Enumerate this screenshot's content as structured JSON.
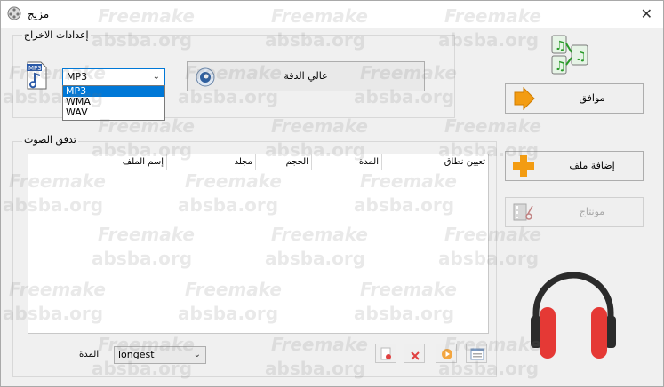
{
  "window": {
    "title": "مزيج",
    "close_glyph": "✕"
  },
  "output_settings": {
    "label": "إعدادات الاخراج",
    "format_select": {
      "value": "MP3",
      "options": [
        "MP3",
        "WMA",
        "WAV"
      ],
      "selected_index": 0
    },
    "quality_button_label": "عالي الدقة",
    "file_icon_text": "MP3"
  },
  "audio_stream": {
    "label": "تدفق الصوت",
    "columns": [
      "إسم الملف",
      "مجلد",
      "الحجم",
      "المدة",
      "تعيين نطاق"
    ]
  },
  "duration": {
    "label": "المدة",
    "value": "longest"
  },
  "actions": {
    "ok_label": "موافق",
    "add_file_label": "إضافة ملف",
    "montage_label": "مونتاج"
  },
  "watermark": {
    "line1": "Freemake",
    "line2": "absba.org"
  },
  "colors": {
    "accent": "#0078d7",
    "headphones_red": "#e53935",
    "add_orange": "#f39c12"
  }
}
